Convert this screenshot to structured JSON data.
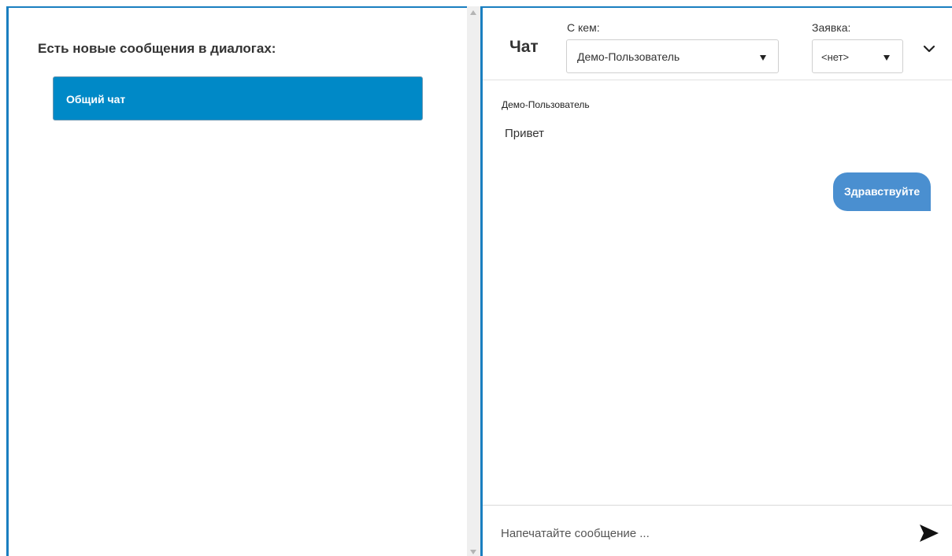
{
  "left": {
    "heading": "Есть новые сообщения в диалогах:",
    "dialogs": [
      {
        "label": "Общий чат"
      }
    ]
  },
  "chat": {
    "title": "Чат",
    "with_label": "С кем:",
    "with_value": "Демо-Пользователь",
    "ticket_label": "Заявка:",
    "ticket_value": "<нет>",
    "messages": [
      {
        "sender": "Демо-Пользователь",
        "text": "Привет",
        "direction": "incoming"
      },
      {
        "text": "Здравствуйте",
        "direction": "outgoing"
      }
    ],
    "input_placeholder": "Напечатайте сообщение ..."
  },
  "colors": {
    "accent": "#1a7fc0",
    "dialog_item_bg": "#0089c7",
    "outgoing_bubble": "#4a8fd0"
  },
  "icons": {
    "collapse": "chevron-down-icon",
    "send": "send-icon"
  }
}
